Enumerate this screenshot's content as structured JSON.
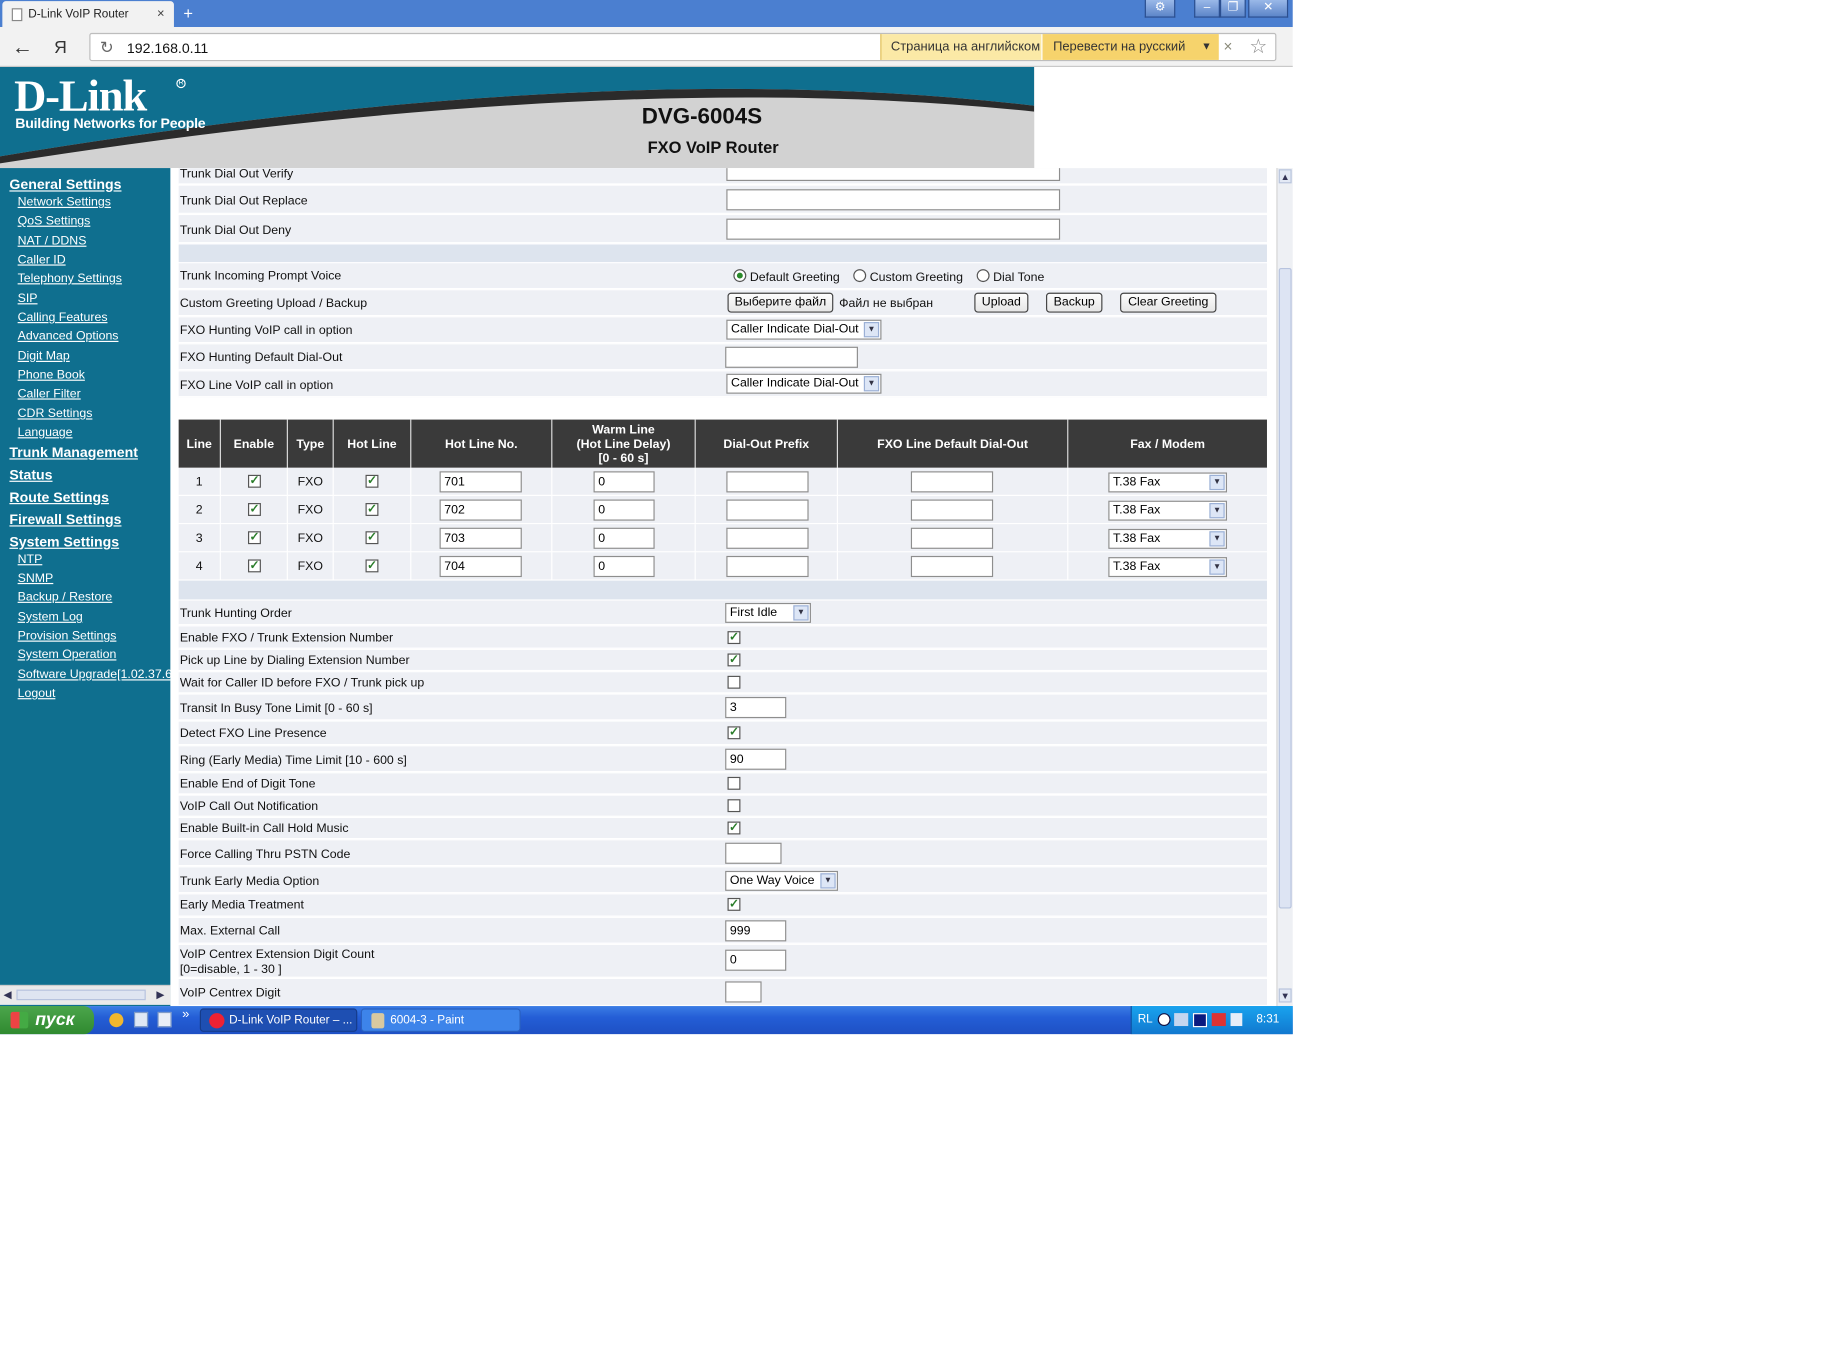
{
  "browser": {
    "tab_title": "D-Link VoIP Router",
    "url": "192.168.0.11",
    "back_glyph": "←",
    "yandex_glyph": "Я",
    "reload_glyph": "↻",
    "star_glyph": "☆",
    "translate_lang": "Страница на английском",
    "translate_btn": "Перевести на русский",
    "close_glyph": "×",
    "newtab_glyph": "+"
  },
  "header": {
    "logo": "D-Link",
    "slogan": "Building Networks for People",
    "model": "DVG-6004S",
    "subtitle": "FXO VoIP Router"
  },
  "sidebar": {
    "general": "General Settings",
    "general_items": [
      "Network Settings",
      "QoS Settings",
      "NAT / DDNS",
      "Caller ID",
      "Telephony Settings",
      "SIP",
      "Calling Features",
      "Advanced Options",
      "Digit Map",
      "Phone Book",
      "Caller Filter",
      "CDR Settings",
      "Language"
    ],
    "trunk": "Trunk Management",
    "status": "Status",
    "route": "Route Settings",
    "firewall": "Firewall Settings",
    "system": "System Settings",
    "system_items": [
      "NTP",
      "SNMP",
      "Backup / Restore",
      "System Log",
      "Provision Settings",
      "System Operation",
      "Software Upgrade[1.02.37.6",
      "Logout"
    ]
  },
  "trunk_top": {
    "dial_out_verify": "Trunk Dial Out Verify",
    "dial_out_replace": "Trunk Dial Out Replace",
    "dial_out_deny": "Trunk Dial Out Deny",
    "prompt_voice": "Trunk Incoming Prompt Voice",
    "radio_default": "Default Greeting",
    "radio_custom": "Custom Greeting",
    "radio_dial": "Dial Tone",
    "greeting_upload": "Custom Greeting Upload / Backup",
    "choose_file": "Выберите файл",
    "no_file": "Файл не выбран",
    "upload": "Upload",
    "backup": "Backup",
    "clear_greeting": "Clear Greeting",
    "hunting_voip": "FXO Hunting VoIP call in option",
    "hunting_voip_value": "Caller Indicate Dial-Out",
    "hunting_default": "FXO Hunting Default Dial-Out",
    "line_voip": "FXO Line VoIP call in option",
    "line_voip_value": "Caller Indicate Dial-Out"
  },
  "table": {
    "headers": [
      "Line",
      "Enable",
      "Type",
      "Hot Line",
      "Hot Line No.",
      "Warm Line\n(Hot Line Delay)\n[0 - 60 s]",
      "Dial-Out Prefix",
      "FXO Line Default Dial-Out",
      "Fax / Modem"
    ],
    "rows": [
      {
        "line": "1",
        "type": "FXO",
        "hotline_no": "701",
        "warm": "0",
        "fax": "T.38 Fax"
      },
      {
        "line": "2",
        "type": "FXO",
        "hotline_no": "702",
        "warm": "0",
        "fax": "T.38 Fax"
      },
      {
        "line": "3",
        "type": "FXO",
        "hotline_no": "703",
        "warm": "0",
        "fax": "T.38 Fax"
      },
      {
        "line": "4",
        "type": "FXO",
        "hotline_no": "704",
        "warm": "0",
        "fax": "T.38 Fax"
      }
    ]
  },
  "settings": {
    "hunting_order": "Trunk Hunting Order",
    "hunting_order_value": "First Idle",
    "enable_ext": "Enable FXO / Trunk Extension Number",
    "pickup": "Pick up Line by Dialing Extension Number",
    "wait_cid": "Wait for Caller ID before FXO / Trunk pick up",
    "busy_tone": "Transit In Busy Tone Limit [0 - 60 s]",
    "busy_tone_value": "3",
    "detect_line": "Detect FXO Line Presence",
    "ring_limit": "Ring (Early Media) Time Limit [10 - 600 s]",
    "ring_limit_value": "90",
    "end_digit": "Enable End of Digit Tone",
    "callout_notify": "VoIP Call Out Notification",
    "hold_music": "Enable Built-in Call Hold Music",
    "force_pstn": "Force Calling Thru PSTN Code",
    "early_media_opt": "Trunk Early Media Option",
    "early_media_opt_value": "One Way Voice",
    "early_media_treat": "Early Media Treatment",
    "max_ext": "Max. External Call",
    "max_ext_value": "999",
    "centrex_count_1": "VoIP Centrex Extension Digit Count",
    "centrex_count_2": "[0=disable, 1 - 30 ]",
    "centrex_count_value": "0",
    "centrex_digit": "VoIP Centrex Digit",
    "check": "✓"
  },
  "taskbar": {
    "start": "пуск",
    "task1": "D-Link VoIP Router – ...",
    "task2": "6004-3 - Paint",
    "chevron": "»",
    "lang": "RL",
    "time": "8:31"
  }
}
